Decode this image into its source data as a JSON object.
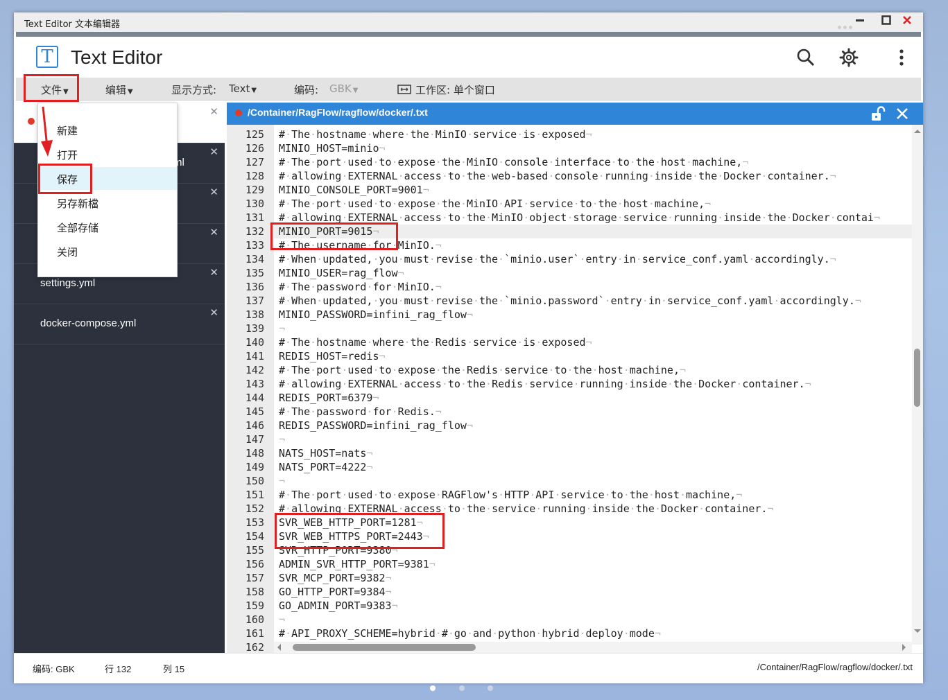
{
  "window": {
    "title": "Text Editor 文本编辑器"
  },
  "app": {
    "title": "Text Editor",
    "logo_letter": "T"
  },
  "toolbar": {
    "file": "文件",
    "edit": "编辑",
    "display_label": "显示方式:",
    "display_value": "Text",
    "encoding_label": "编码:",
    "encoding_value": "GBK",
    "workspace_label": "工作区: 单个窗口"
  },
  "file_menu": {
    "items": [
      "新建",
      "打开",
      "保存",
      "另存新檔",
      "全部存储",
      "关闭"
    ],
    "highlighted": "保存"
  },
  "sidebar": {
    "tabs": [
      {
        "name": ""
      },
      {
        "name": "ml"
      },
      {
        "name": ""
      },
      {
        "name": ""
      },
      {
        "name": "settings.yml"
      },
      {
        "name": "docker-compose.yml"
      }
    ]
  },
  "editor": {
    "path": "/Container/RagFlow/ragflow/docker/.txt",
    "current_line": 132,
    "lines": [
      {
        "n": 125,
        "t": "# The hostname where the MinIO service is exposed"
      },
      {
        "n": 126,
        "t": "MINIO_HOST=minio"
      },
      {
        "n": 127,
        "t": "# The port used to expose the MinIO console interface to the host machine,"
      },
      {
        "n": 128,
        "t": "# allowing EXTERNAL access to the web-based console running inside the Docker container."
      },
      {
        "n": 129,
        "t": "MINIO_CONSOLE_PORT=9001"
      },
      {
        "n": 130,
        "t": "# The port used to expose the MinIO API service to the host machine,"
      },
      {
        "n": 131,
        "t": "# allowing EXTERNAL access to the MinIO object storage service running inside the Docker contai"
      },
      {
        "n": 132,
        "t": "MINIO_PORT=9015"
      },
      {
        "n": 133,
        "t": "# The username for MinIO."
      },
      {
        "n": 134,
        "t": "# When updated, you must revise the `minio.user` entry in service_conf.yaml accordingly."
      },
      {
        "n": 135,
        "t": "MINIO_USER=rag_flow"
      },
      {
        "n": 136,
        "t": "# The password for MinIO."
      },
      {
        "n": 137,
        "t": "# When updated, you must revise the `minio.password` entry in service_conf.yaml accordingly."
      },
      {
        "n": 138,
        "t": "MINIO_PASSWORD=infini_rag_flow"
      },
      {
        "n": 139,
        "t": ""
      },
      {
        "n": 140,
        "t": "# The hostname where the Redis service is exposed"
      },
      {
        "n": 141,
        "t": "REDIS_HOST=redis"
      },
      {
        "n": 142,
        "t": "# The port used to expose the Redis service to the host machine,"
      },
      {
        "n": 143,
        "t": "# allowing EXTERNAL access to the Redis service running inside the Docker container."
      },
      {
        "n": 144,
        "t": "REDIS_PORT=6379"
      },
      {
        "n": 145,
        "t": "# The password for Redis."
      },
      {
        "n": 146,
        "t": "REDIS_PASSWORD=infini_rag_flow"
      },
      {
        "n": 147,
        "t": ""
      },
      {
        "n": 148,
        "t": "NATS_HOST=nats"
      },
      {
        "n": 149,
        "t": "NATS_PORT=4222"
      },
      {
        "n": 150,
        "t": ""
      },
      {
        "n": 151,
        "t": "# The port used to expose RAGFlow's HTTP API service to the host machine,"
      },
      {
        "n": 152,
        "t": "# allowing EXTERNAL access to the service running inside the Docker container."
      },
      {
        "n": 153,
        "t": "SVR_WEB_HTTP_PORT=1281"
      },
      {
        "n": 154,
        "t": "SVR_WEB_HTTPS_PORT=2443"
      },
      {
        "n": 155,
        "t": "SVR_HTTP_PORT=9380"
      },
      {
        "n": 156,
        "t": "ADMIN_SVR_HTTP_PORT=9381"
      },
      {
        "n": 157,
        "t": "SVR_MCP_PORT=9382"
      },
      {
        "n": 158,
        "t": "GO_HTTP_PORT=9384"
      },
      {
        "n": 159,
        "t": "GO_ADMIN_PORT=9383"
      },
      {
        "n": 160,
        "t": ""
      },
      {
        "n": 161,
        "t": "# API_PROXY_SCHEME=hybrid # go and python hybrid deploy mode"
      },
      {
        "n": 162,
        "t": ""
      }
    ]
  },
  "status": {
    "encoding": "编码: GBK",
    "row": "行 132",
    "col": "列 15",
    "path": "/Container/RagFlow/ragflow/docker/.txt"
  },
  "colors": {
    "accent": "#2f86d8",
    "sidebar": "#2c313d",
    "highlight": "#e02020"
  }
}
